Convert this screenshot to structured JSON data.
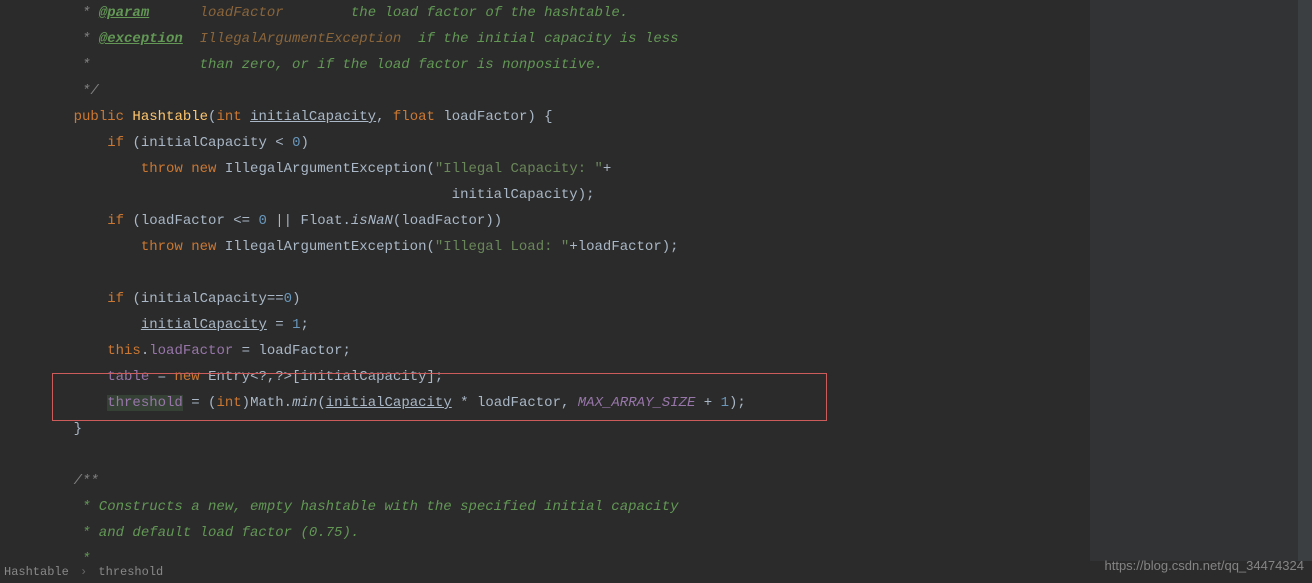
{
  "lines": {
    "l1_pre": "     * ",
    "l1_tag": "@param",
    "l1_space": "      ",
    "l1_name": "loadFactor",
    "l1_space2": "        ",
    "l1_text": "the load factor of the hashtable.",
    "l2_pre": "     * ",
    "l2_tag": "@exception",
    "l2_space": "  ",
    "l2_name": "IllegalArgumentException",
    "l2_space2": "  ",
    "l2_text": "if the initial capacity is less",
    "l3_pre": "     *             ",
    "l3_text": "than zero, or if the load factor is nonpositive.",
    "l4_pre": "     */",
    "l5_ind": "    ",
    "l5_public": "public",
    "l5_method": " Hashtable",
    "l5_p1": "(",
    "l5_int": "int ",
    "l5_initcap": "initialCapacity",
    "l5_comma": ", ",
    "l5_float": "float ",
    "l5_lf": "loadFactor",
    "l5_p2": ") {",
    "l6_ind": "        ",
    "l6_if": "if ",
    "l6_p1": "(initialCapacity < ",
    "l6_zero": "0",
    "l6_p2": ")",
    "l7_ind": "            ",
    "l7_throw": "throw new ",
    "l7_ex": "IllegalArgumentException(",
    "l7_str": "\"Illegal Capacity: \"",
    "l7_plus": "+",
    "l8_ind": "                                                 ",
    "l8_txt": "initialCapacity);",
    "l9_ind": "        ",
    "l9_if": "if ",
    "l9_p1": "(loadFactor <= ",
    "l9_zero": "0",
    "l9_or": " || Float.",
    "l9_isnan": "isNaN",
    "l9_p2": "(loadFactor))",
    "l10_ind": "            ",
    "l10_throw": "throw new ",
    "l10_ex": "IllegalArgumentException(",
    "l10_str": "\"Illegal Load: \"",
    "l10_rest": "+loadFactor);",
    "l12_ind": "        ",
    "l12_if": "if ",
    "l12_p1": "(initialCapacity==",
    "l12_zero": "0",
    "l12_p2": ")",
    "l13_ind": "            ",
    "l13_initcap": "initialCapacity",
    "l13_rest": " = ",
    "l13_one": "1",
    "l13_semi": ";",
    "l14_ind": "        ",
    "l14_this": "this",
    "l14_dot": ".",
    "l14_lf": "loadFactor",
    "l14_rest": " = loadFactor;",
    "l15_ind": "        ",
    "l15_table": "table",
    "l15_eq": " = ",
    "l15_new": "new ",
    "l15_entry": "Entry<?,?>[initialCapacity];",
    "l16_ind": "        ",
    "l16_threshold": "threshold",
    "l16_eq": " = (",
    "l16_int": "int",
    "l16_math": ")Math.",
    "l16_min": "min",
    "l16_p1": "(",
    "l16_initcap": "initialCapacity",
    "l16_mul": " * loadFactor, ",
    "l16_max": "MAX_ARRAY_SIZE",
    "l16_plus": " + ",
    "l16_one": "1",
    "l16_p2": ");",
    "l17": "    }",
    "l19": "    /**",
    "l20": "     * Constructs a new, empty hashtable with the specified initial capacity",
    "l21": "     * and default load factor (0.75).",
    "l22": "     *"
  },
  "breadcrumb": {
    "item1": "Hashtable",
    "item2": "threshold"
  },
  "watermark": "https://blog.csdn.net/qq_34474324"
}
